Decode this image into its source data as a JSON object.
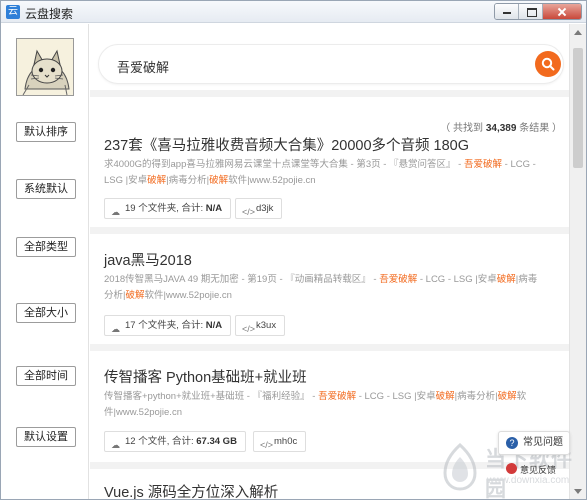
{
  "window": {
    "title": "云盘搜索",
    "app_icon": "cloud-search-app-icon",
    "icon_glyph": "云"
  },
  "sidebar": {
    "buttons": [
      {
        "label": "默认排序"
      },
      {
        "label": "系统默认"
      },
      {
        "label": "全部类型"
      },
      {
        "label": "全部大小"
      },
      {
        "label": "全部时间"
      },
      {
        "label": "默认设置"
      }
    ]
  },
  "search": {
    "query": "吾爱破解"
  },
  "results_summary": {
    "prefix": "（ 共找到",
    "count": "34,389",
    "suffix": "条结果 ）"
  },
  "results": [
    {
      "title": "237套《喜马拉雅收费音频大合集》20000多个音频 180G",
      "desc_parts": [
        {
          "t": "求4000G的得到app喜马拉雅网易云课堂十点课堂等大合集 - 第3页 - 『悬赏问答区』 - ",
          "h": false
        },
        {
          "t": "吾爱破解",
          "h": true
        },
        {
          "t": " - LCG - LSG |安卓",
          "h": false
        },
        {
          "t": "破解",
          "h": true
        },
        {
          "t": "|病毒分析|",
          "h": false
        },
        {
          "t": "破解",
          "h": true
        },
        {
          "t": "软件|www.52pojie.cn",
          "h": false
        }
      ],
      "files_prefix": "19 个文件夹, 合计: ",
      "files_size": "N/A",
      "code": "d3jk"
    },
    {
      "title": "java黑马2018",
      "desc_parts": [
        {
          "t": "2018传智黑马JAVA 49 期无加密 - 第19页 - 『动画精品转载区』 - ",
          "h": false
        },
        {
          "t": "吾爱破解",
          "h": true
        },
        {
          "t": " - LCG - LSG |安卓",
          "h": false
        },
        {
          "t": "破解",
          "h": true
        },
        {
          "t": "|病毒分析|",
          "h": false
        },
        {
          "t": "破解",
          "h": true
        },
        {
          "t": "软件|www.52pojie.cn",
          "h": false
        }
      ],
      "files_prefix": "17 个文件夹, 合计: ",
      "files_size": "N/A",
      "code": "k3ux"
    },
    {
      "title": "传智播客 Python基础班+就业班",
      "desc_parts": [
        {
          "t": "传智播客+python+就业班+基础班 - 『福利经验』 - ",
          "h": false
        },
        {
          "t": "吾爱破解",
          "h": true
        },
        {
          "t": " - LCG - LSG |安卓",
          "h": false
        },
        {
          "t": "破解",
          "h": true
        },
        {
          "t": "|病毒分析|",
          "h": false
        },
        {
          "t": "破解",
          "h": true
        },
        {
          "t": "软件|www.52pojie.cn",
          "h": false
        }
      ],
      "files_prefix": "12 个文件, 合计: ",
      "files_size": "67.34 GB",
      "code": "mh0c"
    },
    {
      "title": "Vue.js 源码全方位深入解析"
    }
  ],
  "floating": {
    "help_label": "常见问题",
    "feedback_label": "意见反馈"
  },
  "watermark": {
    "main": "当下软件园",
    "sub": "www.downxia.com"
  },
  "colors": {
    "accent": "#f26a1e",
    "highlight": "#f26a1e",
    "desc_text": "#999999"
  }
}
